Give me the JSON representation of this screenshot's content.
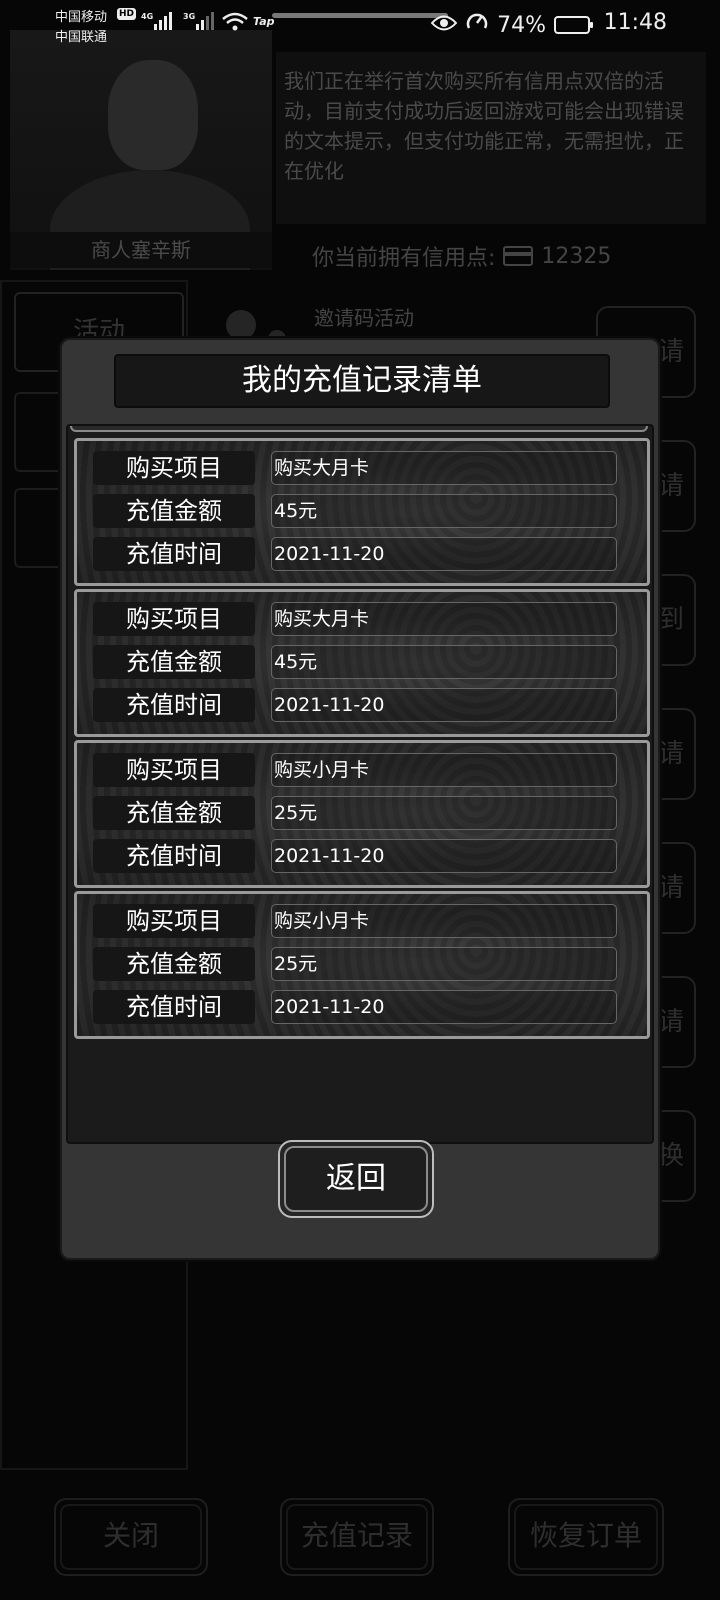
{
  "status_bar": {
    "carrier1": "中国移动",
    "carrier2": "中国联通",
    "hd_badge": "HD",
    "net1": "4G",
    "net2": "3G",
    "tap_label": "Tap",
    "battery_percent": "74%",
    "battery_level": 0.74,
    "time": "11:48"
  },
  "background": {
    "merchant_name": "商人塞辛斯",
    "notice_text": "我们正在举行首次购买所有信用点双倍的活动，目前支付成功后返回游戏可能会出现错误的文本提示，但支付功能正常，无需担忧，正在优化",
    "credits_label": "你当前拥有信用点:",
    "credits_value": "12325",
    "tab_label": "活动",
    "invite_label": "邀请码活动",
    "right_buttons": [
      "请",
      "请",
      "到",
      "请",
      "请",
      "请",
      "换"
    ],
    "bottom_buttons": {
      "close": "关闭",
      "recharge_records": "充值记录",
      "restore_order": "恢复订单"
    }
  },
  "modal": {
    "title": "我的充值记录清单",
    "field_labels": {
      "item": "购买项目",
      "amount": "充值金额",
      "time": "充值时间"
    },
    "records": [
      {
        "item": "购买大月卡",
        "amount": "45元",
        "time": "2021-11-20"
      },
      {
        "item": "购买大月卡",
        "amount": "45元",
        "time": "2021-11-20"
      },
      {
        "item": "购买小月卡",
        "amount": "25元",
        "time": "2021-11-20"
      },
      {
        "item": "购买小月卡",
        "amount": "25元",
        "time": "2021-11-20"
      }
    ],
    "back_button": "返回"
  }
}
